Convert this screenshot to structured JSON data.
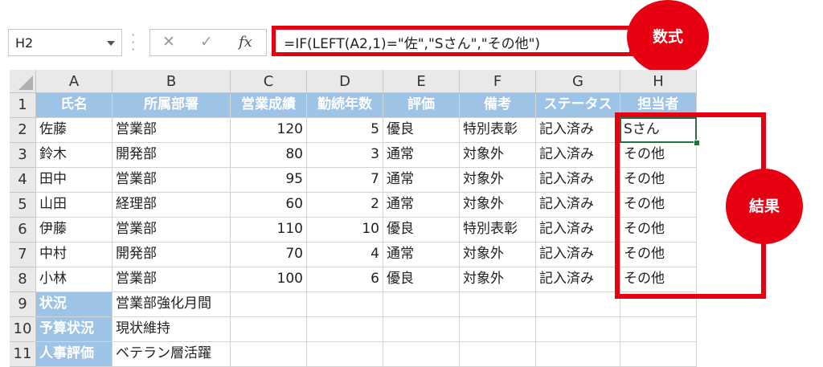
{
  "name_box": "H2",
  "formula_bar": {
    "cancel_icon": "✕",
    "enter_icon": "✓",
    "fx_label": "fx",
    "formula": "=IF(LEFT(A2,1)=\"佐\",\"Sさん\",\"その他\")"
  },
  "columns": [
    "A",
    "B",
    "C",
    "D",
    "E",
    "F",
    "G",
    "H"
  ],
  "rows": [
    "1",
    "2",
    "3",
    "4",
    "5",
    "6",
    "7",
    "8",
    "9",
    "10",
    "11"
  ],
  "table": {
    "headers": [
      "氏名",
      "所属部署",
      "営業成績",
      "勤続年数",
      "評価",
      "備考",
      "ステータス",
      "担当者"
    ],
    "data": [
      [
        "佐藤",
        "営業部",
        "120",
        "5",
        "優良",
        "特別表彰",
        "記入済み",
        "Sさん"
      ],
      [
        "鈴木",
        "開発部",
        "80",
        "3",
        "通常",
        "対象外",
        "記入済み",
        "その他"
      ],
      [
        "田中",
        "営業部",
        "95",
        "7",
        "通常",
        "対象外",
        "記入済み",
        "その他"
      ],
      [
        "山田",
        "経理部",
        "60",
        "2",
        "通常",
        "対象外",
        "記入済み",
        "その他"
      ],
      [
        "伊藤",
        "営業部",
        "110",
        "10",
        "優良",
        "特別表彰",
        "記入済み",
        "その他"
      ],
      [
        "中村",
        "開発部",
        "70",
        "4",
        "通常",
        "対象外",
        "記入済み",
        "その他"
      ],
      [
        "小林",
        "営業部",
        "100",
        "6",
        "優良",
        "対象外",
        "記入済み",
        "その他"
      ]
    ],
    "notes": [
      [
        "状況",
        "営業部強化月間"
      ],
      [
        "予算状況",
        "現状維持"
      ],
      [
        "人事評価",
        "ベテラン層活躍"
      ]
    ]
  },
  "annotations": {
    "formula_label": "数式",
    "result_label": "結果"
  },
  "colors": {
    "header_fill": "#9dc3e6",
    "accent_red": "#e60012",
    "active_cell_border": "#217346"
  }
}
